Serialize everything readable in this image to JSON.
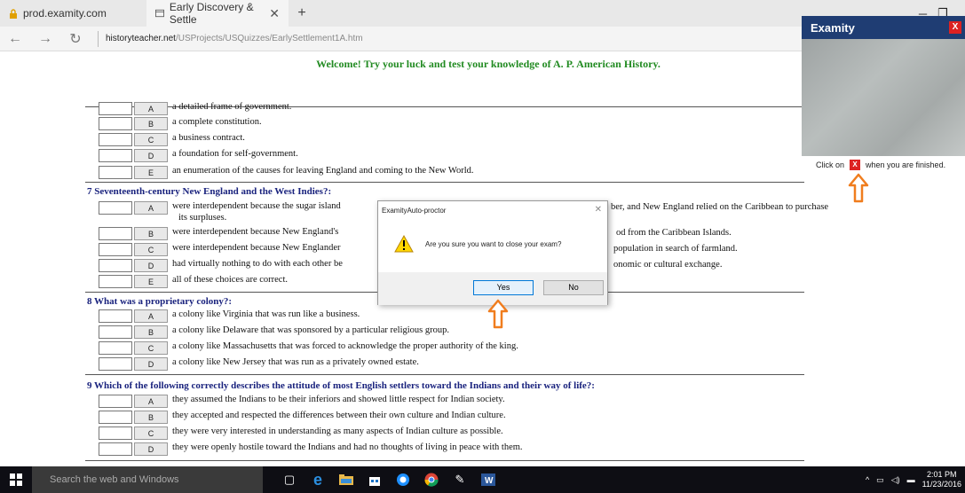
{
  "browser": {
    "tabs": [
      {
        "label": "prod.examity.com",
        "active": false
      },
      {
        "label": "Early Discovery & Settle",
        "active": true
      }
    ],
    "new_tab_label": "+",
    "url_host": "historyteacher.net",
    "url_path": "/USProjects/USQuizzes/EarlySettlement1A.htm"
  },
  "page": {
    "welcome": "Welcome! Try your luck and test your knowledge of A. P. American History.",
    "q6_answers": [
      {
        "letter": "A",
        "text": "a detailed frame of government."
      },
      {
        "letter": "B",
        "text": "a complete constitution."
      },
      {
        "letter": "C",
        "text": "a business contract."
      },
      {
        "letter": "D",
        "text": "a foundation for self-government."
      },
      {
        "letter": "E",
        "text": "an enumeration of the causes for leaving England and coming to the New World."
      }
    ],
    "q7": {
      "heading": "7  Seventeenth-century New England and the West Indies?:",
      "answers": [
        {
          "letter": "A",
          "text": "were interdependent because the sugar island",
          "text_right": "ber, and New England relied on the Caribbean to purchase",
          "text_wrap": "its surpluses."
        },
        {
          "letter": "B",
          "text": "were interdependent because New England's",
          "text_right": "od from the Caribbean Islands."
        },
        {
          "letter": "C",
          "text": "were interdependent because New Englander",
          "text_right": "population in search of farmland."
        },
        {
          "letter": "D",
          "text": "had virtually nothing to do with each other be",
          "text_right": "onomic or cultural exchange."
        },
        {
          "letter": "E",
          "text": "all of these choices are correct."
        }
      ]
    },
    "q8": {
      "heading": "8  What was a proprietary colony?:",
      "answers": [
        {
          "letter": "A",
          "text": "a colony like Virginia that was run like a business."
        },
        {
          "letter": "B",
          "text": "a colony like Delaware that was sponsored by a particular religious group."
        },
        {
          "letter": "C",
          "text": "a colony like Massachusetts that was forced to acknowledge the proper authority of the king."
        },
        {
          "letter": "D",
          "text": "a colony like New Jersey that was run as a privately owned estate."
        }
      ]
    },
    "q9": {
      "heading": "9  Which of the following correctly describes the attitude of most English settlers toward the Indians and their way of life?:",
      "answers": [
        {
          "letter": "A",
          "text": "they assumed the Indians to be their inferiors and showed little respect for Indian society."
        },
        {
          "letter": "B",
          "text": "they accepted and respected the differences between their own culture and Indian culture."
        },
        {
          "letter": "C",
          "text": "they were very interested in understanding as many aspects of Indian culture as possible."
        },
        {
          "letter": "D",
          "text": "they were openly hostile toward the Indians and had no thoughts of living in peace with them."
        }
      ]
    }
  },
  "examity": {
    "title": "Examity",
    "close_glyph": "X",
    "hint_before": "Click on",
    "hint_after": "when you are finished."
  },
  "dialog": {
    "title": "ExamityAuto-proctor",
    "message": "Are you sure you want to close your exam?",
    "yes_label": "Yes",
    "no_label": "No"
  },
  "taskbar": {
    "search_placeholder": "Search the web and Windows",
    "time": "2:01 PM",
    "date": "11/23/2016"
  },
  "colors": {
    "welcome": "#228b22",
    "question": "#1a237e",
    "examity_bar": "#1f3d73",
    "arrow": "#f07d1e"
  }
}
